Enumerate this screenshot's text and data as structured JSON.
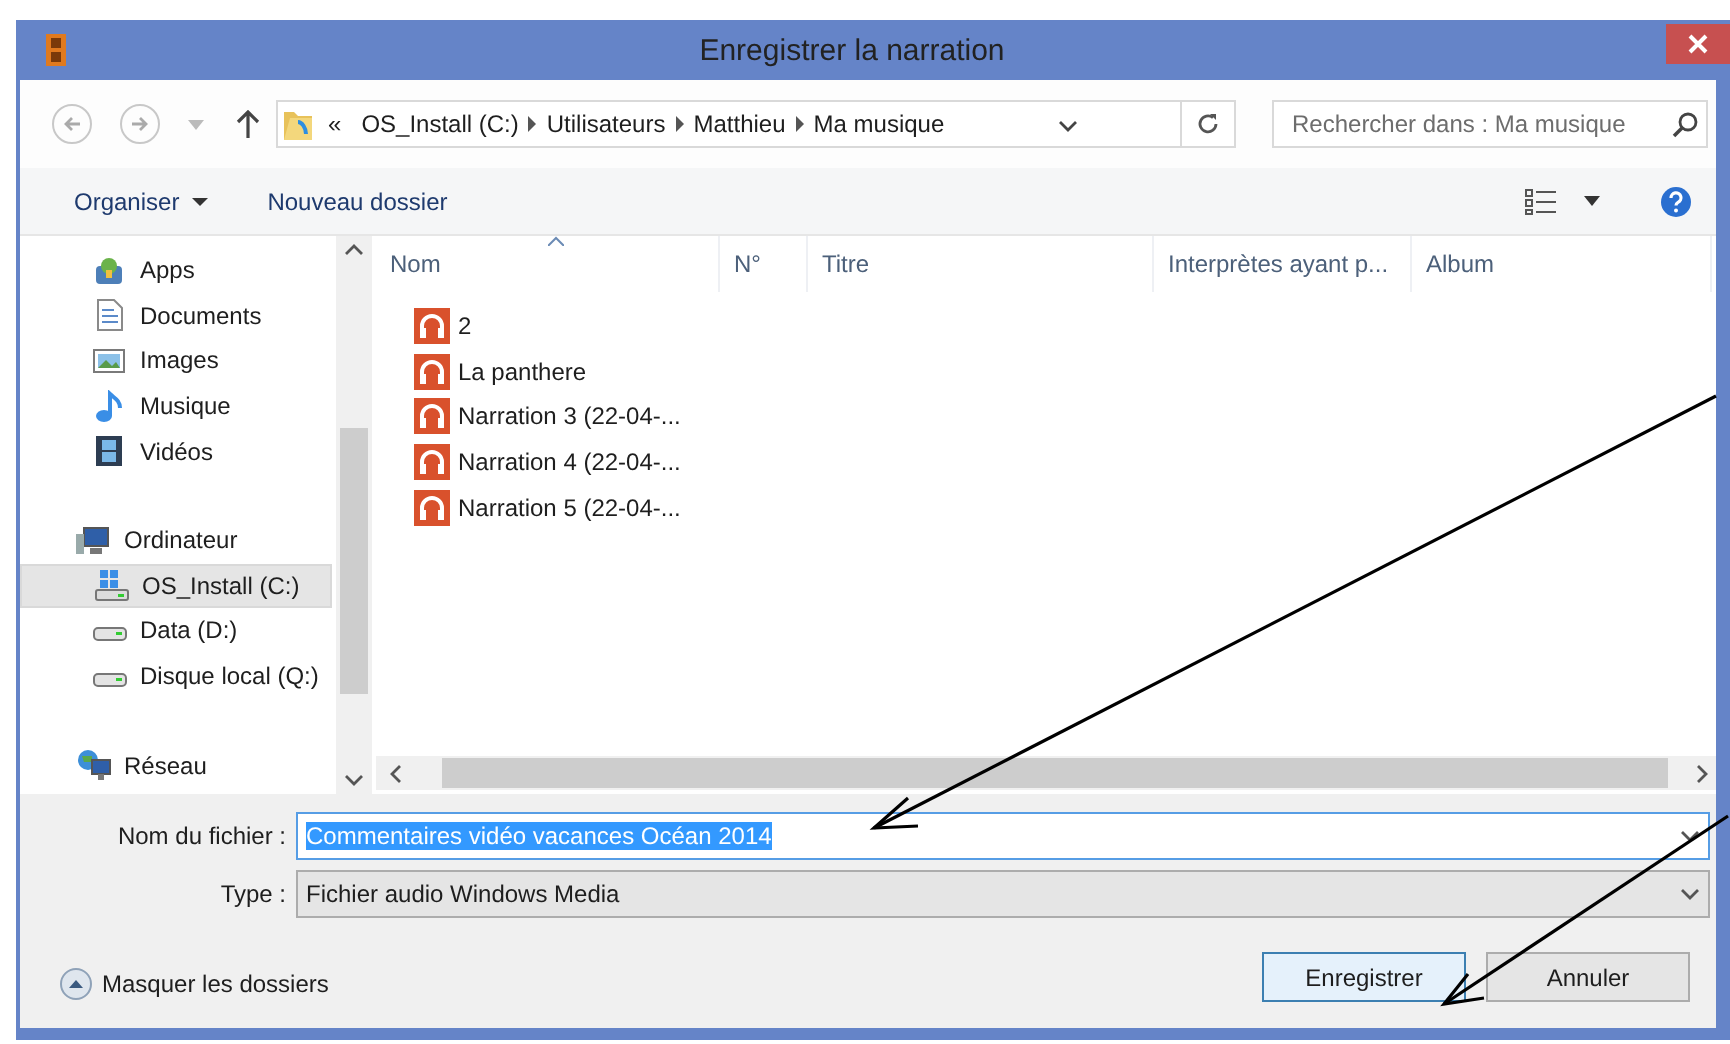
{
  "window": {
    "title": "Enregistrer la narration"
  },
  "navigation": {
    "overflow_mark": "«",
    "path": [
      "OS_Install (C:)",
      "Utilisateurs",
      "Matthieu",
      "Ma musique"
    ],
    "search": {
      "placeholder": "Rechercher dans : Ma musique"
    }
  },
  "toolbar": {
    "items": [
      {
        "label": "Organiser",
        "kind": "menu"
      },
      {
        "label": "Nouveau dossier",
        "kind": "button"
      }
    ]
  },
  "sidebar": {
    "libraries": [
      {
        "label": "Apps",
        "kind": "apps",
        "selected": false
      },
      {
        "label": "Documents",
        "kind": "documents",
        "selected": false
      },
      {
        "label": "Images",
        "kind": "images",
        "selected": false
      },
      {
        "label": "Musique",
        "kind": "music",
        "selected": false
      },
      {
        "label": "Vidéos",
        "kind": "videos",
        "selected": false
      }
    ],
    "tree": [
      {
        "label": "Ordinateur",
        "kind": "computer",
        "selected": false,
        "children": [
          {
            "label": "OS_Install (C:)",
            "kind": "system-drive",
            "selected": true
          },
          {
            "label": "Data (D:)",
            "kind": "drive",
            "selected": false
          },
          {
            "label": "Disque local (Q:)",
            "kind": "drive",
            "selected": false
          }
        ]
      },
      {
        "label": "Réseau",
        "kind": "network",
        "selected": false
      }
    ]
  },
  "table": {
    "columns": [
      {
        "label": "Nom",
        "sorted": true
      },
      {
        "label": "N°",
        "sorted": false
      },
      {
        "label": "Titre",
        "sorted": false
      },
      {
        "label": "Interprètes ayant p...",
        "sorted": false
      },
      {
        "label": "Album",
        "sorted": false
      }
    ],
    "rows": [
      {
        "name": "2"
      },
      {
        "name": "La panthere"
      },
      {
        "name": "Narration 3 (22-04-..."
      },
      {
        "name": "Narration 4 (22-04-..."
      },
      {
        "name": "Narration 5 (22-04-..."
      }
    ]
  },
  "file_name": {
    "label": "Nom du fichier :",
    "value": "Commentaires vidéo vacances Océan 2014",
    "text_selected": true
  },
  "file_type": {
    "label": "Type :",
    "value": "Fichier audio Windows Media"
  },
  "footer": {
    "toggle": "Masquer les dossiers",
    "buttons": [
      {
        "label": "Enregistrer",
        "default": true
      },
      {
        "label": "Annuler",
        "default": false
      }
    ]
  }
}
